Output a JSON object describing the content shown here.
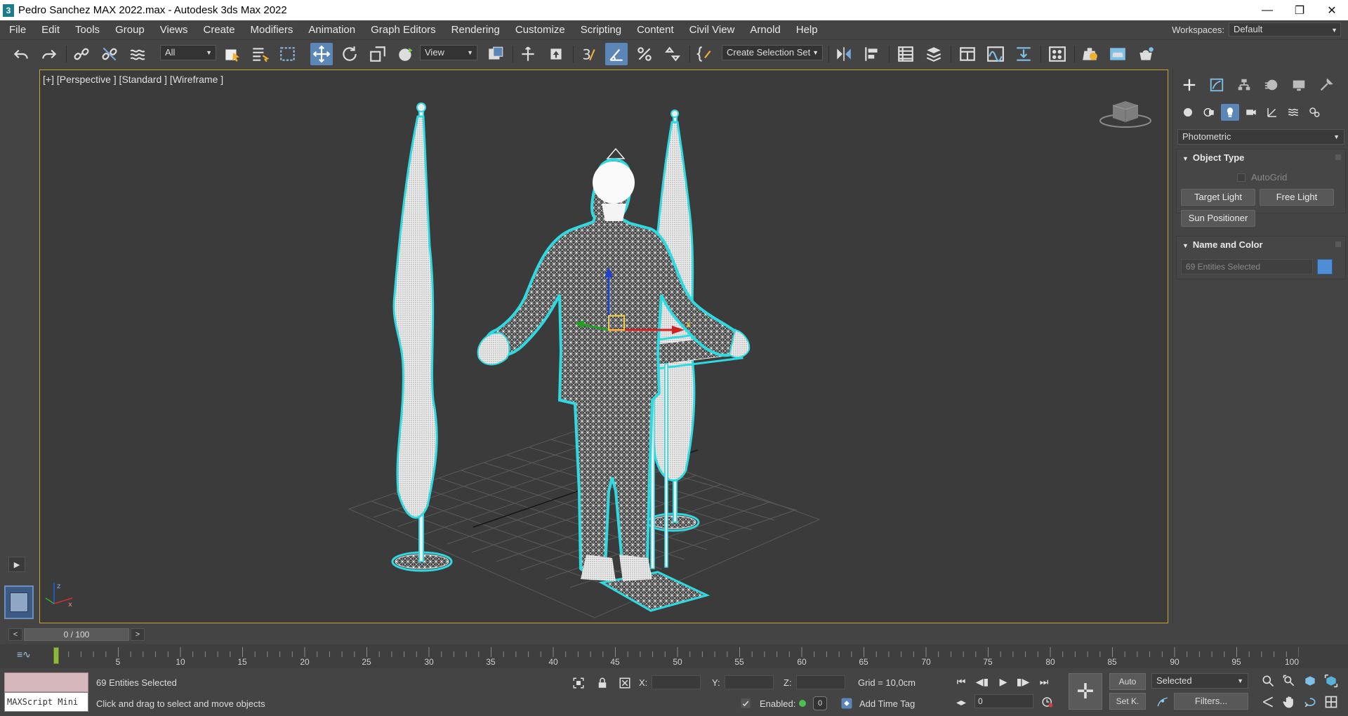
{
  "window": {
    "title": "Pedro Sanchez MAX 2022.max - Autodesk 3ds Max 2022",
    "app_icon": "3",
    "minimize": "—",
    "restore": "❐",
    "close": "✕"
  },
  "menu": [
    "File",
    "Edit",
    "Tools",
    "Group",
    "Views",
    "Create",
    "Modifiers",
    "Animation",
    "Graph Editors",
    "Rendering",
    "Customize",
    "Scripting",
    "Content",
    "Civil View",
    "Arnold",
    "Help"
  ],
  "workspaces": {
    "label": "Workspaces:",
    "value": "Default"
  },
  "toolbar": {
    "filter_value": "All",
    "refcoord_value": "View",
    "selection_set_value": "Create Selection Set",
    "snap_value": "3"
  },
  "viewport": {
    "label": "[+] [Perspective ] [Standard ] [Wireframe ]"
  },
  "command_panel": {
    "category": "Photometric",
    "object_type": {
      "title": "Object Type",
      "autogrid": "AutoGrid",
      "buttons": [
        "Target Light",
        "Free Light",
        "Sun Positioner"
      ]
    },
    "name_and_color": {
      "title": "Name and Color",
      "name_value": "69 Entities Selected",
      "color": "#4f8dd6"
    }
  },
  "time_slider": {
    "prev": "<",
    "position": "0 / 100",
    "next": ">"
  },
  "track_bar": {
    "ticks": [
      "5",
      "10",
      "15",
      "20",
      "25",
      "30",
      "35",
      "40",
      "45",
      "50",
      "55",
      "60",
      "65",
      "70",
      "75",
      "80",
      "85",
      "90",
      "95",
      "100"
    ]
  },
  "status": {
    "maxscript": "MAXScript Mini",
    "selection": "69 Entities Selected",
    "prompt": "Click and drag to select and move objects",
    "x_label": "X:",
    "y_label": "Y:",
    "z_label": "Z:",
    "grid": "Grid = 10,0cm",
    "enabled_label": "Enabled:",
    "enabled_value": "0",
    "add_time_tag": "Add Time Tag",
    "frame_value": "0",
    "auto_key": "Auto",
    "set_key": "Set K.",
    "key_filter": "Selected",
    "filters": "Filters..."
  },
  "colors": {
    "selection_outline": "#2fd9e0",
    "viewport_border": "#c9a530",
    "active_button": "#5b86b8"
  }
}
